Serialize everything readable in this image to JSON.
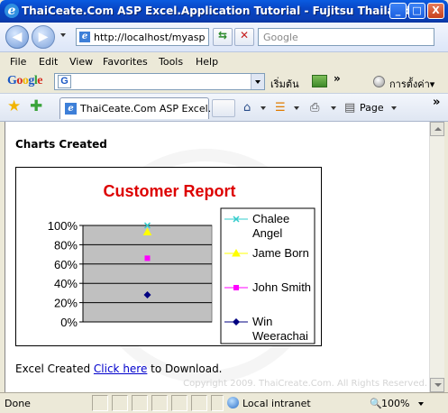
{
  "window": {
    "title": "ThaiCeate.Com ASP Excel.Application Tutorial - Fujitsu Thailand",
    "minimize": "_",
    "maximize": "□",
    "close": "X"
  },
  "address_bar": {
    "url": "http://localhost/myasp",
    "search_placeholder": "Google"
  },
  "menu": [
    "File",
    "Edit",
    "View",
    "Favorites",
    "Tools",
    "Help"
  ],
  "google_toolbar": {
    "logo": [
      "G",
      "o",
      "o",
      "g",
      "l",
      "e"
    ],
    "logo_colors": [
      "#1a57c4",
      "#d62d20",
      "#f0b400",
      "#1a57c4",
      "#2e9e3d",
      "#d62d20"
    ],
    "search_badge": "G",
    "start_label": "เริ่มต้น",
    "more": "»",
    "settings_label": "การตั้งค่า▾"
  },
  "command_bar": {
    "tab_title": "ThaiCeate.Com ASP Excel...",
    "page_label": "Page",
    "more": "»"
  },
  "page": {
    "heading": "Charts Created",
    "footer_prefix": "Excel Created ",
    "footer_link": "Click here",
    "footer_suffix": " to Download.",
    "copyright": "Copyright 2009. ThaiCreate.Com. All Rights Reserved."
  },
  "chart_data": {
    "type": "scatter",
    "title": "Customer Report",
    "title_color": "#dd0000",
    "plot_background": "#c0c0c0",
    "ylim": [
      0,
      100
    ],
    "y_ticks": [
      "100%",
      "80%",
      "60%",
      "40%",
      "20%",
      "0%"
    ],
    "grid": true,
    "legend_position": "right",
    "series": [
      {
        "name": "Chalee Angel",
        "value": 100,
        "color": "#33cccc",
        "marker": "x"
      },
      {
        "name": "Jame Born",
        "value": 93,
        "color": "#ffff00",
        "marker": "triangle"
      },
      {
        "name": "John Smith",
        "value": 66,
        "color": "#ff00ff",
        "marker": "square"
      },
      {
        "name": "Win Weerachai",
        "value": 28,
        "color": "#000080",
        "marker": "diamond"
      }
    ]
  },
  "status_bar": {
    "text": "Done",
    "zone": "Local intranet",
    "zoom_icon": "🔍",
    "zoom": "100%"
  }
}
